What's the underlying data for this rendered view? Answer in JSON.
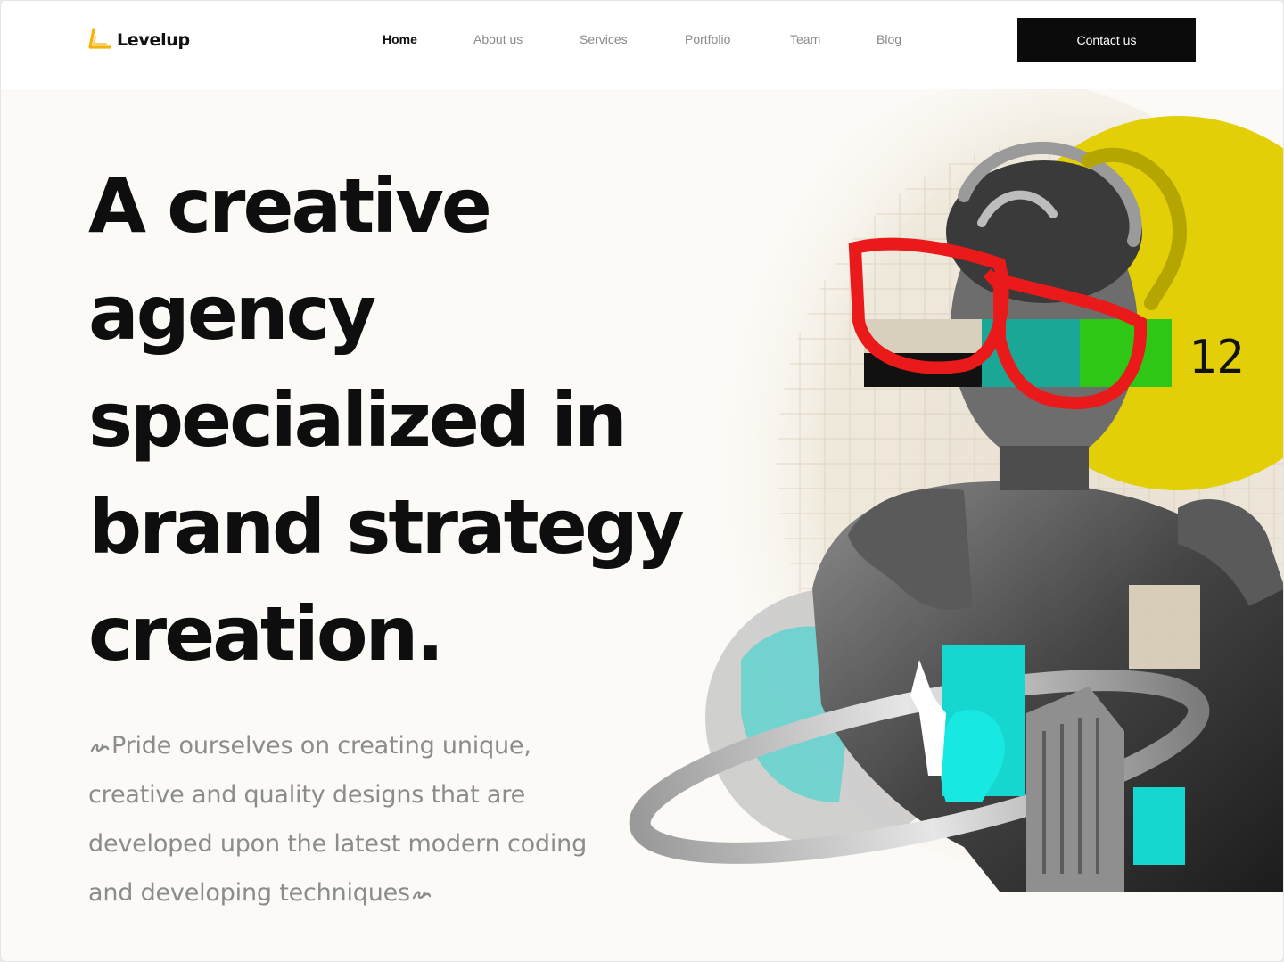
{
  "header": {
    "brand": "Levelup",
    "nav": [
      {
        "label": "Home",
        "active": true
      },
      {
        "label": "About us",
        "active": false
      },
      {
        "label": "Services",
        "active": false
      },
      {
        "label": "Portfolio",
        "active": false
      },
      {
        "label": "Team",
        "active": false
      },
      {
        "label": "Blog",
        "active": false
      }
    ],
    "cta_label": "Contact us"
  },
  "hero": {
    "title_lines": [
      "A creative",
      "agency",
      "specialized in",
      "brand strategy",
      "creation."
    ],
    "subtitle": "Pride ourselves on creating unique, creative and quality designs that are developed upon the latest modern coding and developing techniques"
  },
  "collage": {
    "number_text": "12",
    "icons": [
      "statue-bust",
      "red-glasses-icon",
      "yellow-circle",
      "planet-ring",
      "cyan-figure"
    ]
  },
  "colors": {
    "accent": "#f5b30a",
    "yellow": "#e2cf08",
    "red": "#ea1a1a",
    "cyan": "#16d6d0",
    "dark": "#0b0b0b",
    "bg": "#fcfaf6"
  }
}
